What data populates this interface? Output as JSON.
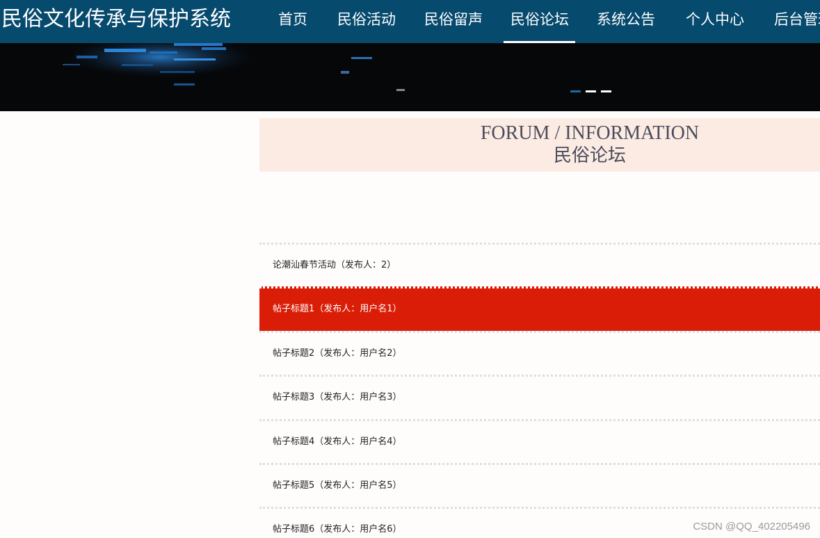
{
  "header": {
    "site_title": "民俗文化传承与保护系统",
    "nav": [
      {
        "label": "首页",
        "active": false
      },
      {
        "label": "民俗活动",
        "active": false
      },
      {
        "label": "民俗留声",
        "active": false
      },
      {
        "label": "民俗论坛",
        "active": true
      },
      {
        "label": "系统公告",
        "active": false
      },
      {
        "label": "个人中心",
        "active": false
      },
      {
        "label": "后台管理",
        "active": false
      }
    ],
    "colors": {
      "background": "#064a6e",
      "text": "#ffffff"
    }
  },
  "banner": {
    "slides": 3,
    "active_slide": 1,
    "colors": {
      "active_dot": "#1e6aa1",
      "dot": "#ffffff"
    }
  },
  "section": {
    "title_en": "FORUM / INFORMATION",
    "title_cn": "民俗论坛",
    "background": "#fcebe3"
  },
  "forum": {
    "posts": [
      {
        "title": "论潮汕春节活动（发布人：2）",
        "highlighted": false
      },
      {
        "title": "帖子标题1（发布人：用户名1）",
        "highlighted": true
      },
      {
        "title": "帖子标题2（发布人：用户名2）",
        "highlighted": false
      },
      {
        "title": "帖子标题3（发布人：用户名3）",
        "highlighted": false
      },
      {
        "title": "帖子标题4（发布人：用户名4）",
        "highlighted": false
      },
      {
        "title": "帖子标题5（发布人：用户名5）",
        "highlighted": false
      },
      {
        "title": "帖子标题6（发布人：用户名6）",
        "highlighted": false
      }
    ],
    "highlight_color": "#da1d07"
  },
  "watermark": "CSDN @QQ_402205496"
}
